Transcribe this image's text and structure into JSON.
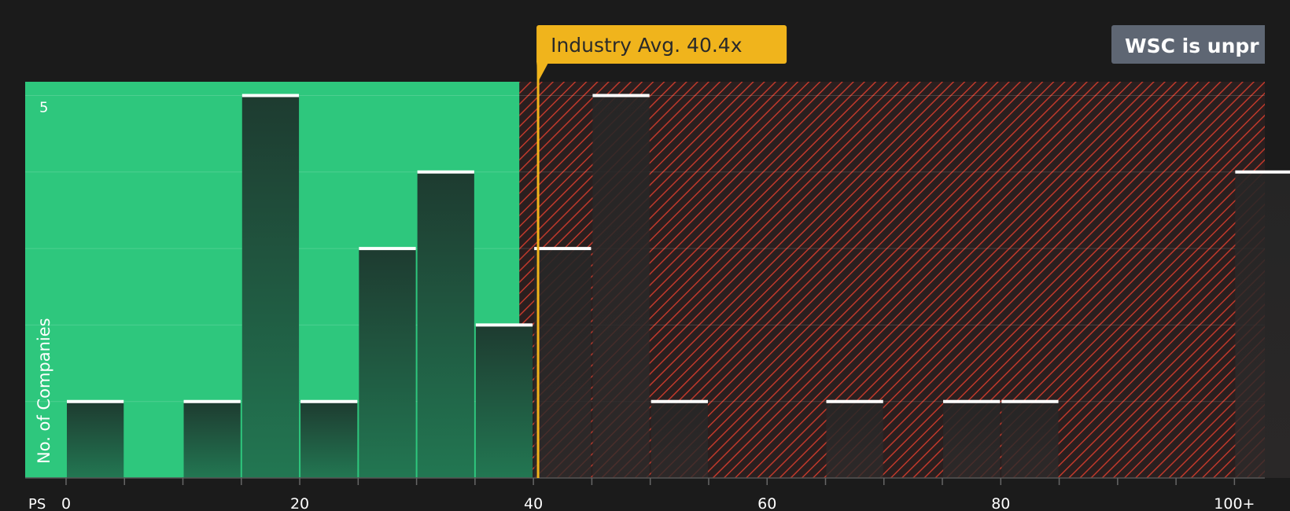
{
  "chart_data": {
    "type": "bar",
    "ylabel": "No. of Companies",
    "x_axis_prefix": "PS",
    "x_tick_labels": [
      "0",
      "20",
      "40",
      "60",
      "80",
      "100+"
    ],
    "x_tick_values": [
      0,
      20,
      40,
      60,
      80,
      100
    ],
    "xlim": [
      -3.5,
      102.6
    ],
    "ylim": [
      0,
      5.18
    ],
    "y_tick_labels": [
      "5"
    ],
    "y_tick_values": [
      5
    ],
    "gridlines": [
      1,
      2,
      3,
      4,
      5
    ],
    "bin_width": 5,
    "bins": [
      {
        "start": 0,
        "value": 1
      },
      {
        "start": 10,
        "value": 1
      },
      {
        "start": 15,
        "value": 5
      },
      {
        "start": 20,
        "value": 1
      },
      {
        "start": 25,
        "value": 3
      },
      {
        "start": 30,
        "value": 4
      },
      {
        "start": 35,
        "value": 2
      },
      {
        "start": 40,
        "value": 3
      },
      {
        "start": 45,
        "value": 5
      },
      {
        "start": 50,
        "value": 1
      },
      {
        "start": 65,
        "value": 1
      },
      {
        "start": 75,
        "value": 1
      },
      {
        "start": 80,
        "value": 1
      },
      {
        "start": 100,
        "value": 4
      }
    ],
    "fair_value_boundary": 38.8,
    "industry_avg_value": 40.4,
    "industry_avg_label": "Industry Avg. 40.4x",
    "company_label": "WSC is unpr",
    "colors": {
      "background": "#1b1b1b",
      "undervalued_zone": "#2ec77d",
      "overvalued_hatch": "#c0392b",
      "avg_marker": "#f0b41c",
      "company_badge": "#5e6673",
      "bar_cap": "#ffffff"
    }
  }
}
